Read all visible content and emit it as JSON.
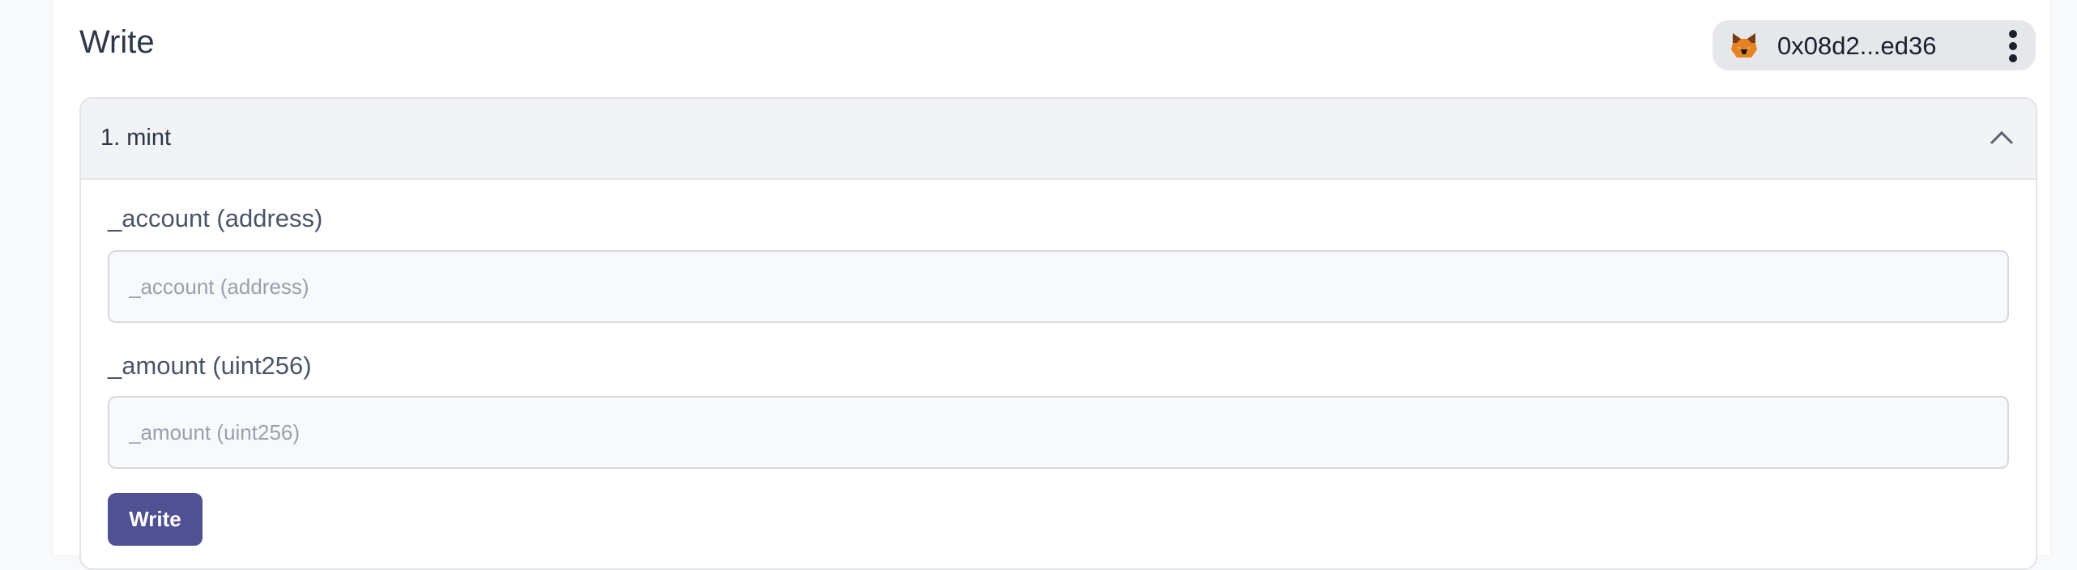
{
  "header": {
    "title": "Write"
  },
  "wallet": {
    "address": "0x08d2...ed36",
    "icon": "metamask-fox-icon",
    "menu_icon": "kebab-menu-icon"
  },
  "accordion": {
    "title": "1. mint",
    "fields": [
      {
        "label": "_account (address)",
        "placeholder": "_account (address)",
        "value": ""
      },
      {
        "label": "_amount (uint256)",
        "placeholder": "_amount (uint256)",
        "value": ""
      }
    ],
    "submit_label": "Write"
  },
  "colors": {
    "button": "#4f5193",
    "pill": "#e5e7eb",
    "header_bg": "#f2f3f5"
  }
}
